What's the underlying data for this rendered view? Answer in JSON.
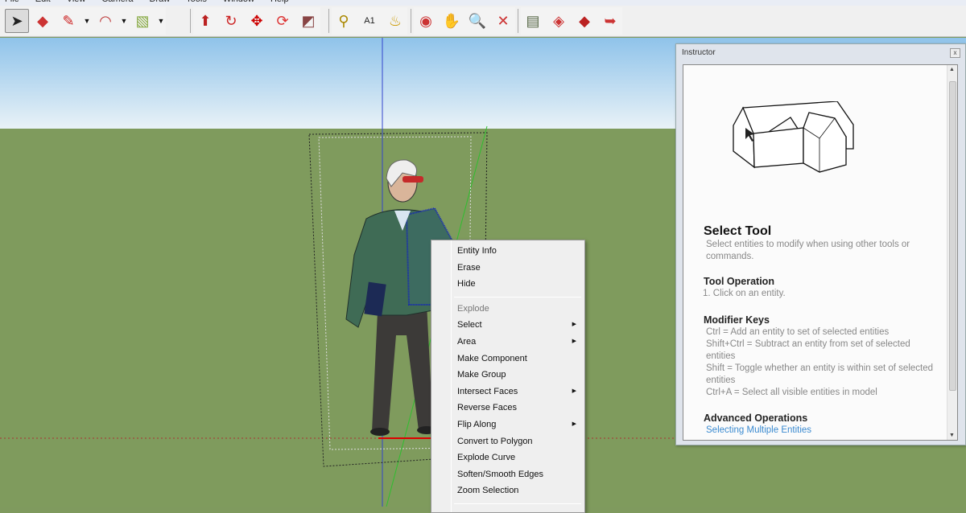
{
  "menu": [
    "File",
    "Edit",
    "View",
    "Camera",
    "Draw",
    "Tools",
    "Window",
    "Help"
  ],
  "toolbar": {
    "groups": [
      [
        {
          "icon": "select-arrow-icon",
          "glyph": "➤",
          "active": true
        },
        {
          "icon": "eraser-icon",
          "glyph": "◆"
        },
        {
          "icon": "pencil-icon",
          "glyph": "✎",
          "dropdown": true
        },
        {
          "icon": "arc-icon",
          "glyph": "◠",
          "dropdown": true
        },
        {
          "icon": "rectangle-icon",
          "glyph": "▧",
          "dropdown": true
        }
      ],
      [
        {
          "icon": "push-pull-icon",
          "glyph": "⬆"
        },
        {
          "icon": "follow-me-icon",
          "glyph": "↻"
        },
        {
          "icon": "move-icon",
          "glyph": "✥"
        },
        {
          "icon": "rotate-icon",
          "glyph": "⟳"
        },
        {
          "icon": "offset-icon",
          "glyph": "◩"
        }
      ],
      [
        {
          "icon": "tape-measure-icon",
          "glyph": "⚲"
        },
        {
          "icon": "text-icon",
          "glyph": "A1"
        },
        {
          "icon": "paint-bucket-icon",
          "glyph": "♨"
        }
      ],
      [
        {
          "icon": "orbit-icon",
          "glyph": "◉"
        },
        {
          "icon": "pan-hand-icon",
          "glyph": "✋"
        },
        {
          "icon": "zoom-icon",
          "glyph": "🔍"
        },
        {
          "icon": "zoom-extents-icon",
          "glyph": "✕"
        }
      ],
      [
        {
          "icon": "get-models-icon",
          "glyph": "▤"
        },
        {
          "icon": "share-model-icon",
          "glyph": "◈"
        },
        {
          "icon": "share-component-icon",
          "glyph": "◆"
        },
        {
          "icon": "extension-warehouse-icon",
          "glyph": "➥"
        }
      ]
    ]
  },
  "context_menu": [
    {
      "label": "Entity Info"
    },
    {
      "label": "Erase"
    },
    {
      "label": "Hide"
    },
    {
      "sep": true
    },
    {
      "label": "Explode",
      "disabled": true
    },
    {
      "label": "Select",
      "submenu": true
    },
    {
      "label": "Area",
      "submenu": true
    },
    {
      "label": "Make Component"
    },
    {
      "label": "Make Group"
    },
    {
      "label": "Intersect Faces",
      "submenu": true
    },
    {
      "label": "Reverse Faces"
    },
    {
      "label": "Flip Along",
      "submenu": true
    },
    {
      "label": "Convert to Polygon"
    },
    {
      "label": "Explode Curve"
    },
    {
      "label": "Soften/Smooth Edges"
    },
    {
      "label": "Zoom Selection"
    },
    {
      "sep": true
    }
  ],
  "instructor": {
    "title": "Instructor",
    "close": "x",
    "heading": "Select Tool",
    "description": "Select entities to modify when using other tools or commands.",
    "tool_operation_heading": "Tool Operation",
    "tool_operation_step": "1.   Click on an entity.",
    "modifier_heading": "Modifier Keys",
    "modifiers": [
      "Ctrl = Add an entity to set of selected entities",
      "Shift+Ctrl = Subtract an entity from set of selected entities",
      "Shift = Toggle whether an entity is within set of selected entities",
      "Ctrl+A = Select all visible entities in model"
    ],
    "advanced_heading": "Advanced Operations",
    "advanced_link": "Selecting Multiple Entities"
  },
  "colors": {
    "sky_top": "#8fc3ea",
    "ground": "#7f9b5d",
    "link": "#3a8ad0",
    "selection": "#1020c0"
  }
}
